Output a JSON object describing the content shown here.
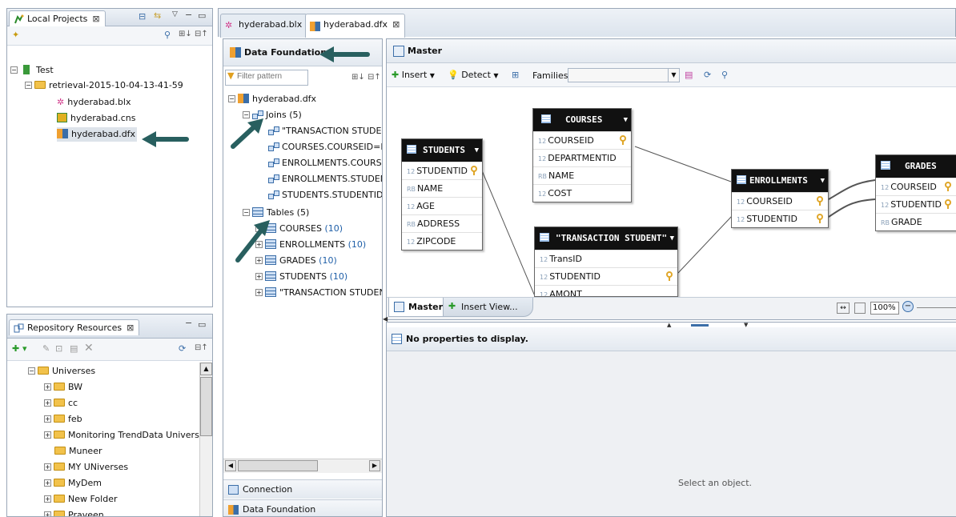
{
  "local_projects": {
    "tab_label": "Local Projects",
    "tree": {
      "root": "Test",
      "folder": "retrieval-2015-10-04-13-41-59",
      "files": [
        "hyderabad.blx",
        "hyderabad.cns",
        "hyderabad.dfx"
      ]
    }
  },
  "repository": {
    "tab_label": "Repository Resources",
    "universes_label": "Universes",
    "folders": [
      "BW",
      "cc",
      "feb",
      "Monitoring TrendData Universes",
      "Muneer",
      "MY UNiverses",
      "MyDem",
      "New Folder",
      "Praveen"
    ]
  },
  "editor_tabs": [
    "hyderabad.blx",
    "hyderabad.dfx"
  ],
  "data_foundation": {
    "title": "Data Foundation",
    "filter_placeholder": "Filter pattern",
    "root": "hyderabad.dfx",
    "joins_label": "Joins (5)",
    "joins": [
      "\"TRANSACTION STUDENT\"",
      "COURSES.COURSEID=ENR",
      "ENROLLMENTS.COURSEID",
      "ENROLLMENTS.STUDENTID",
      "STUDENTS.STUDENTID=\"T"
    ],
    "tables_label": "Tables (5)",
    "tables": [
      {
        "name": "COURSES",
        "count": "(10)"
      },
      {
        "name": "ENROLLMENTS",
        "count": "(10)"
      },
      {
        "name": "GRADES",
        "count": "(10)"
      },
      {
        "name": "STUDENTS",
        "count": "(10)"
      },
      {
        "name": "\"TRANSACTION STUDENT\"",
        "count": ""
      }
    ],
    "bottom_tabs": [
      "Connection",
      "Data Foundation"
    ]
  },
  "master": {
    "title": "Master",
    "toolbar": {
      "insert": "Insert",
      "detect": "Detect",
      "families": "Families"
    },
    "tables": {
      "students": {
        "name": "STUDENTS",
        "cols": [
          [
            "12",
            "STUDENTID"
          ],
          [
            "RB",
            "NAME"
          ],
          [
            "12",
            "AGE"
          ],
          [
            "RB",
            "ADDRESS"
          ],
          [
            "12",
            "ZIPCODE"
          ]
        ]
      },
      "courses": {
        "name": "COURSES",
        "cols": [
          [
            "12",
            "COURSEID"
          ],
          [
            "12",
            "DEPARTMENTID"
          ],
          [
            "RB",
            "NAME"
          ],
          [
            "12",
            "COST"
          ]
        ]
      },
      "transaction": {
        "name": "\"TRANSACTION STUDENT\"",
        "cols": [
          [
            "12",
            "TransID"
          ],
          [
            "12",
            "STUDENTID"
          ],
          [
            "12",
            "AMONT"
          ]
        ]
      },
      "enrollments": {
        "name": "ENROLLMENTS",
        "cols": [
          [
            "12",
            "COURSEID"
          ],
          [
            "12",
            "STUDENTID"
          ]
        ]
      },
      "grades": {
        "name": "GRADES",
        "cols": [
          [
            "12",
            "COURSEID"
          ],
          [
            "12",
            "STUDENTID"
          ],
          [
            "RB",
            "GRADE"
          ]
        ]
      }
    },
    "view_tabs": [
      "Master",
      "Insert View..."
    ],
    "zoom": "100%"
  },
  "properties": {
    "header": "No properties to display.",
    "empty": "Select an object."
  }
}
